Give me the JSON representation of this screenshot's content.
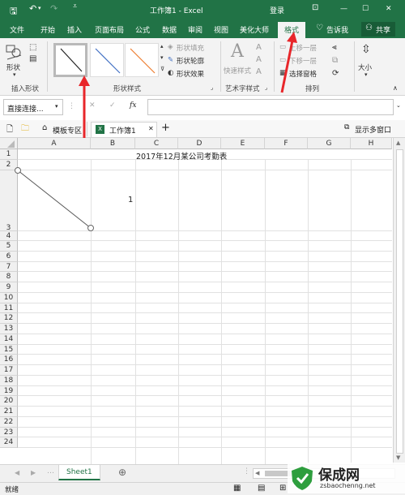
{
  "window": {
    "title": "工作簿1 - Excel",
    "login": "登录",
    "minimize": "—",
    "maximize": "☐",
    "close": "✕"
  },
  "ribbon_tabs": [
    "文件",
    "开始",
    "插入",
    "页面布局",
    "公式",
    "数据",
    "审阅",
    "视图",
    "美化大师",
    "格式"
  ],
  "tell_me": "告诉我",
  "share": "共享",
  "ribbon": {
    "insert_shape": {
      "shape_label": "形状",
      "group_label": "插入形状"
    },
    "shape_styles": {
      "group_label": "形状样式",
      "fill": "形状填充",
      "outline": "形状轮廓",
      "effects": "形状效果"
    },
    "wordart": {
      "quick_styles": "快速样式",
      "group_label": "艺术字样式"
    },
    "arrange": {
      "bring_forward": "上移一层",
      "send_backward": "下移一层",
      "selection_pane": "选择窗格",
      "group_label": "排列"
    },
    "size": {
      "label": "大小"
    }
  },
  "formula_bar": {
    "name_box": "直接连接...",
    "fx": "fx",
    "value": ""
  },
  "workbook_tabs": {
    "template": "模板专区",
    "workbook": "工作簿1",
    "add": "+",
    "show_multi": "显示多窗口"
  },
  "grid": {
    "columns": [
      "A",
      "B",
      "C",
      "D",
      "E",
      "F",
      "G",
      "H"
    ],
    "rows": [
      "1",
      "2",
      "3",
      "4",
      "5",
      "6",
      "7",
      "8",
      "9",
      "10",
      "11",
      "12",
      "13",
      "14",
      "15",
      "16",
      "17",
      "18",
      "19",
      "20",
      "21",
      "22",
      "23",
      "24"
    ],
    "title_cell": "2017年12月某公司考勤表",
    "b2_value": "1"
  },
  "sheet_tab": "Sheet1",
  "status": "就绪",
  "watermark": {
    "brand": "保成网",
    "url": "zsbaochenng.net"
  },
  "colors": {
    "excel_green": "#217346",
    "annotation_red": "#e8262a",
    "shape_line": "#595959"
  }
}
